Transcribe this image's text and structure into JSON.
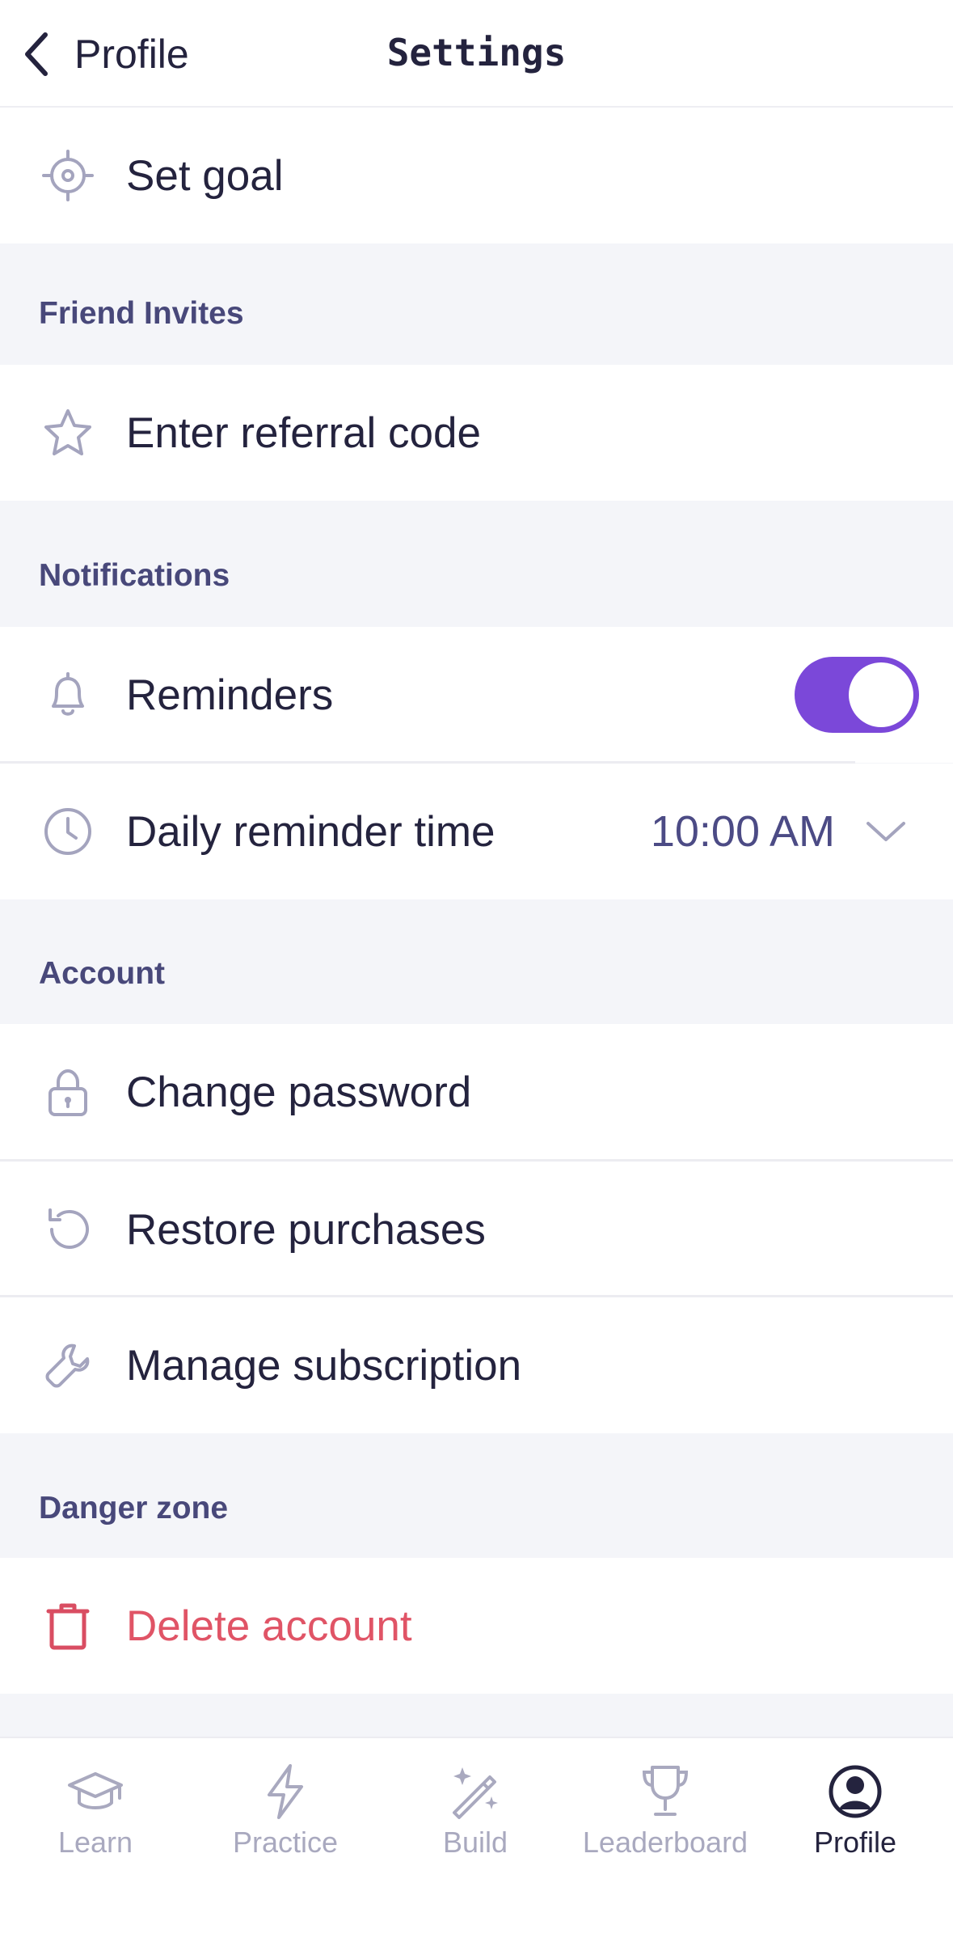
{
  "header": {
    "back_label": "Profile",
    "title": "Settings"
  },
  "rows": {
    "set_goal": "Set goal",
    "referral": "Enter referral code",
    "reminders": "Reminders",
    "reminder_time": "Daily reminder time",
    "reminder_time_value": "10:00 AM",
    "change_password": "Change password",
    "restore_purchases": "Restore purchases",
    "manage_subscription": "Manage subscription",
    "delete_account": "Delete account"
  },
  "sections": {
    "friend_invites": "Friend Invites",
    "notifications": "Notifications",
    "account": "Account",
    "danger_zone": "Danger zone"
  },
  "reminders_enabled": true,
  "tabs": [
    {
      "label": "Learn",
      "icon": "graduation-cap-icon"
    },
    {
      "label": "Practice",
      "icon": "lightning-icon"
    },
    {
      "label": "Build",
      "icon": "magic-wand-icon"
    },
    {
      "label": "Leaderboard",
      "icon": "trophy-icon"
    },
    {
      "label": "Profile",
      "icon": "user-circle-icon",
      "active": true
    }
  ],
  "colors": {
    "accent": "#7b48d9",
    "danger": "#e05466",
    "icon": "#a4a4be",
    "section_text": "#48487a"
  }
}
